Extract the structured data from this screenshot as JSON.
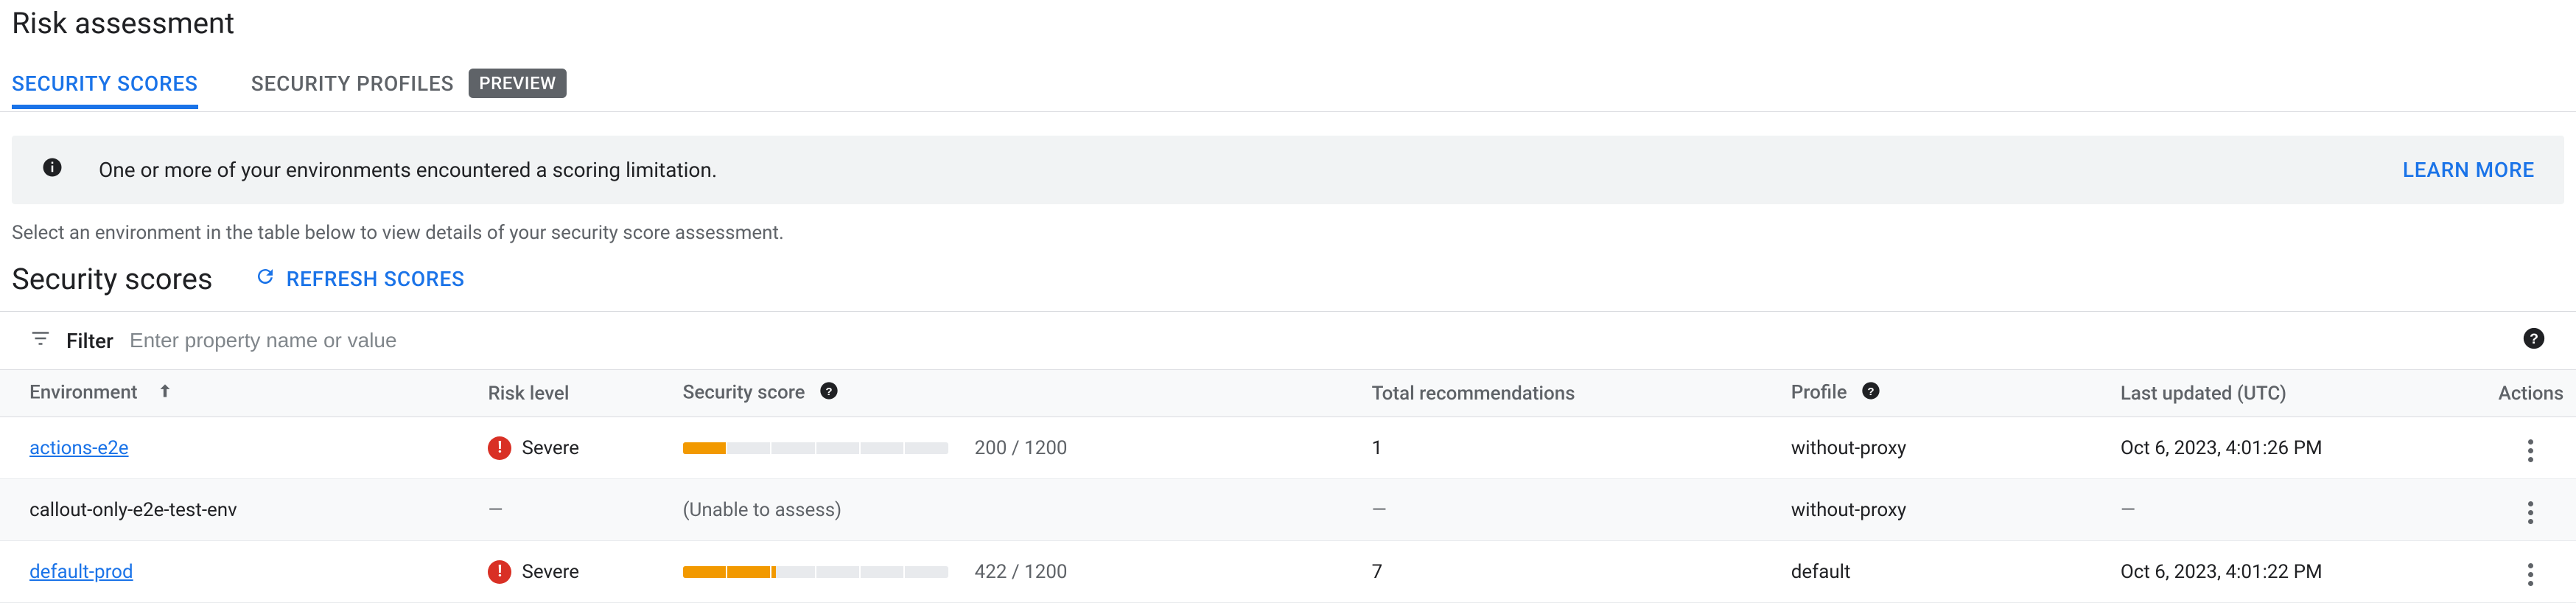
{
  "title": "Risk assessment",
  "tabs": [
    {
      "label": "SECURITY SCORES",
      "active": true
    },
    {
      "label": "SECURITY PROFILES",
      "active": false,
      "badge": "PREVIEW"
    }
  ],
  "alert": {
    "message": "One or more of your environments encountered a scoring limitation.",
    "action": "LEARN MORE"
  },
  "hint": "Select an environment in the table below to view details of your security score assessment.",
  "section": {
    "title": "Security scores",
    "refresh_label": "REFRESH SCORES"
  },
  "filter": {
    "label": "Filter",
    "placeholder": "Enter property name or value"
  },
  "columns": {
    "environment": "Environment",
    "risk_level": "Risk level",
    "security_score": "Security score",
    "total_recs": "Total recommendations",
    "profile": "Profile",
    "last_updated": "Last updated (UTC)",
    "actions": "Actions"
  },
  "rows": [
    {
      "environment": "actions-e2e",
      "env_is_link": true,
      "risk_level": "Severe",
      "risk_icon": true,
      "score_value": 200,
      "score_max": 1200,
      "score_display": "200 / 1200",
      "assessable": true,
      "total_recs": "1",
      "profile": "without-proxy",
      "last_updated": "Oct 6, 2023, 4:01:26 PM"
    },
    {
      "environment": "callout-only-e2e-test-env",
      "env_is_link": false,
      "risk_level": "—",
      "risk_icon": false,
      "assessable": false,
      "unable_text": "(Unable to assess)",
      "total_recs": "—",
      "profile": "without-proxy",
      "last_updated": "—"
    },
    {
      "environment": "default-prod",
      "env_is_link": true,
      "risk_level": "Severe",
      "risk_icon": true,
      "score_value": 422,
      "score_max": 1200,
      "score_display": "422 / 1200",
      "assessable": true,
      "total_recs": "7",
      "profile": "default",
      "last_updated": "Oct 6, 2023, 4:01:22 PM"
    }
  ]
}
